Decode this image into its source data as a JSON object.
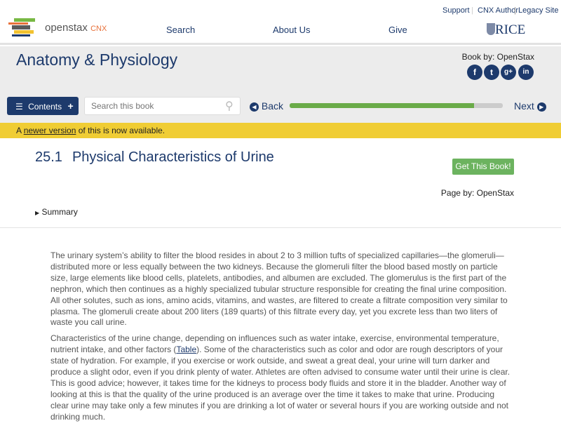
{
  "header": {
    "logo_text": "openstax",
    "logo_suffix": "CNX",
    "utility_links": [
      "Support",
      "CNX Author",
      "Legacy Site"
    ],
    "nav": [
      "Search",
      "About Us",
      "Give"
    ],
    "partner_logo": "RICE"
  },
  "book": {
    "title": "Anatomy & Physiology",
    "by": "Book by: OpenStax",
    "social": [
      "f",
      "t",
      "g+",
      "in"
    ]
  },
  "toolbar": {
    "contents_label": "Contents",
    "search_placeholder": "Search this book",
    "back_label": "Back",
    "next_label": "Next",
    "progress": 0.865
  },
  "notice": {
    "prefix": "A ",
    "link": "newer version",
    "suffix": " of this is now available."
  },
  "section": {
    "number": "25.1",
    "title": "Physical Characteristics of Urine",
    "get_book": "Get This Book!",
    "page_by": "Page by: OpenStax",
    "summary": "Summary"
  },
  "content": {
    "p1": "The urinary system’s ability to filter the blood resides in about 2 to 3 million tufts of specialized capillaries—the glomeruli—distributed more or less equally between the two kidneys. Because the glomeruli filter the blood based mostly on particle size, large elements like blood cells, platelets, antibodies, and albumen are excluded. The glomerulus is the first part of the nephron, which then continues as a highly specialized tubular structure responsible for creating the final urine composition. All other solutes, such as ions, amino acids, vitamins, and wastes, are filtered to create a filtrate composition very similar to plasma. The glomeruli create about 200 liters (189 quarts) of this filtrate every day, yet you excrete less than two liters of waste you call urine.",
    "p2_a": "Characteristics of the urine change, depending on influences such as water intake, exercise, environmental temperature, nutrient intake, and other factors (",
    "p2_link": "Table",
    "p2_b": "). Some of the characteristics such as color and odor are rough descriptors of your state of hydration. For example, if you exercise or work outside, and sweat a great deal, your urine will turn darker and produce a slight odor, even if you drink plenty of water. Athletes are often advised to consume water until their urine is clear. This is good advice; however, it takes time for the kidneys to process body fluids and store it in the bladder. Another way of looking at this is that the quality of the urine produced is an average over the time it takes to make that urine. Producing clear urine may take only a few minutes if you are drinking a lot of water or several hours if you are working outside and not drinking much."
  }
}
